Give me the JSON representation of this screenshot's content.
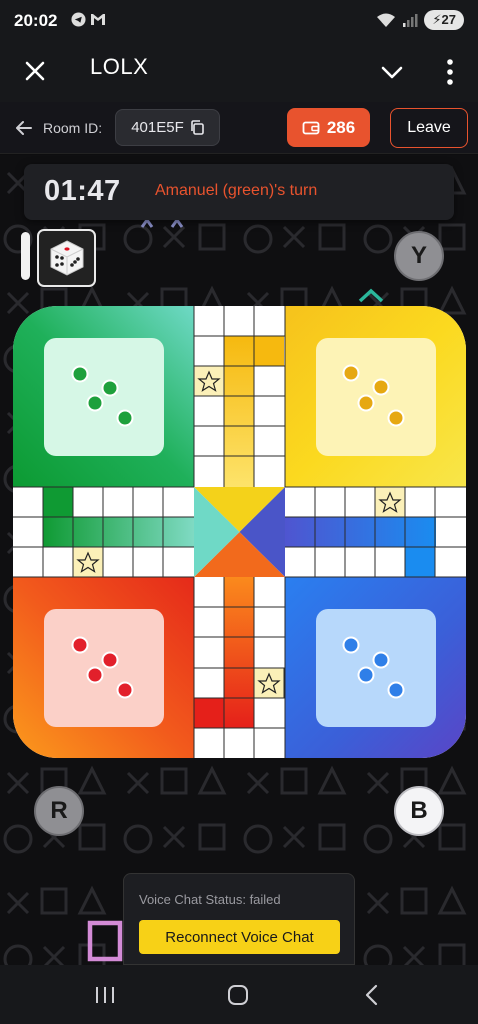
{
  "status_bar": {
    "time": "20:02",
    "battery": "27"
  },
  "app_bar": {
    "title": "LOLX"
  },
  "room": {
    "label": "Room ID:",
    "id": "401E5F",
    "coins": "286",
    "leave_label": "Leave"
  },
  "timer": {
    "time": "01:47",
    "turn_text": "Amanuel (green)'s turn"
  },
  "dice": {
    "value": 5
  },
  "corners": {
    "yellow": "Y",
    "red": "R",
    "blue": "B"
  },
  "board": {
    "colors": {
      "green": "#1a9e3a",
      "yellow": "#f4c20d",
      "red": "#e8371f",
      "blue": "#3a6fe0"
    },
    "home_tokens": {
      "green": 4,
      "yellow": 4,
      "red": 4,
      "blue": 4
    }
  },
  "voice": {
    "status": "Voice Chat Status: failed",
    "button_label": "Reconnect Voice Chat"
  }
}
